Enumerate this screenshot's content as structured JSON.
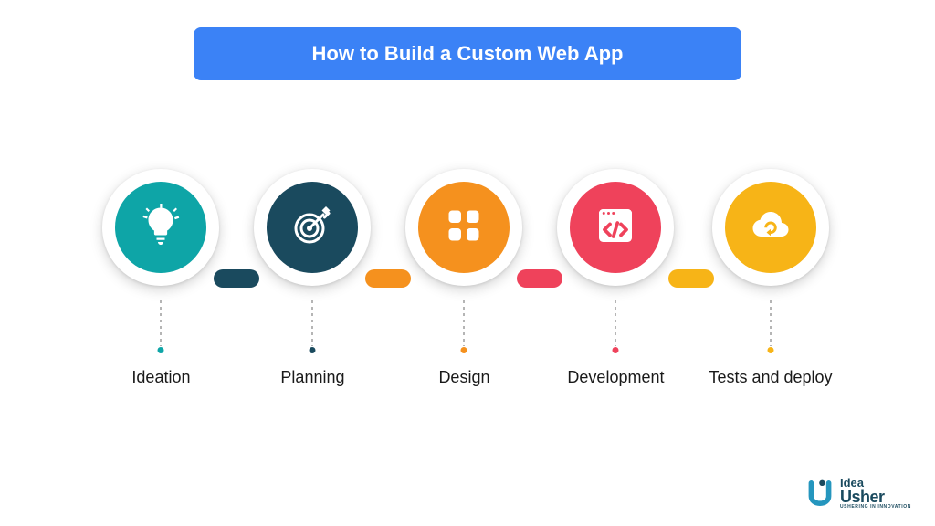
{
  "title": "How to Build a Custom Web App",
  "steps": [
    {
      "label": "Ideation",
      "color": "#0ea5a7",
      "icon": "lightbulb-icon"
    },
    {
      "label": "Planning",
      "color": "#1a4a5e",
      "icon": "target-icon"
    },
    {
      "label": "Design",
      "color": "#f5911e",
      "icon": "grid-icon"
    },
    {
      "label": "Development",
      "color": "#ef425b",
      "icon": "code-window-icon"
    },
    {
      "label": "Tests and deploy",
      "color": "#f7b417",
      "icon": "cloud-sync-icon"
    }
  ],
  "brand": {
    "name_part1": "Idea",
    "name_part2": "Usher",
    "tagline": "USHERING IN INNOVATION"
  }
}
